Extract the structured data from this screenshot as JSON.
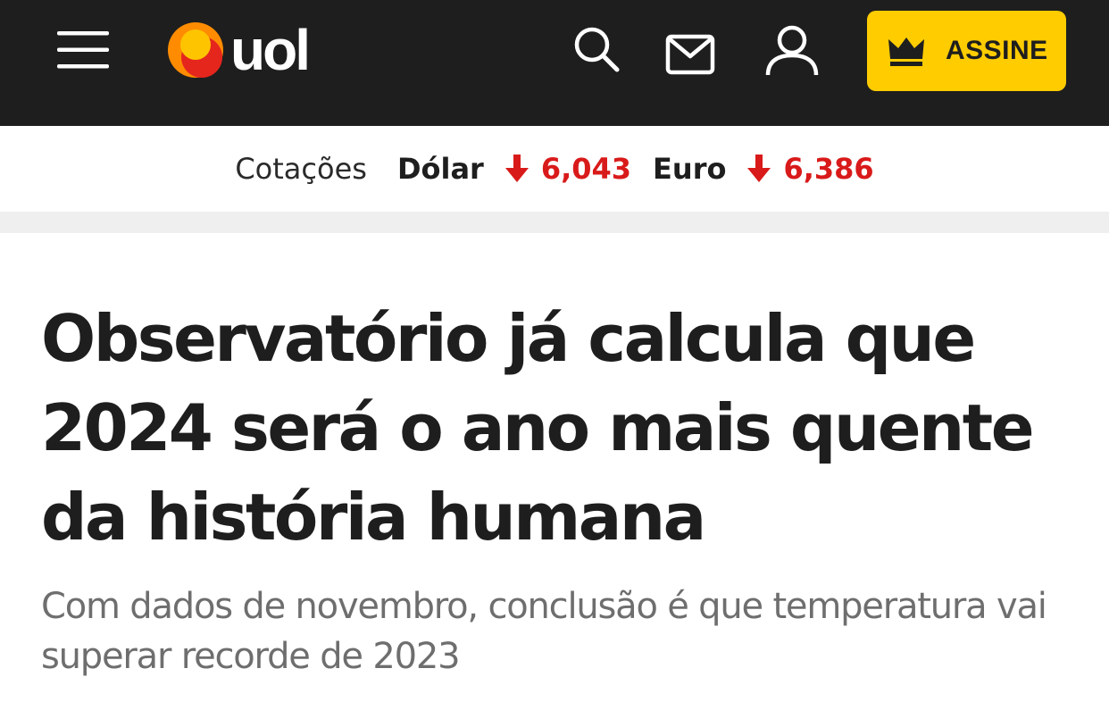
{
  "header": {
    "logo_text": "uol",
    "icons": {
      "menu": "menu-icon",
      "search": "search-icon",
      "mail": "mail-icon",
      "user": "user-icon",
      "crown": "crown-icon"
    },
    "subscribe_label": "ASSINE",
    "colors": {
      "background": "#1e1e1e",
      "accent": "#ffcc00",
      "logo_orange": "#ff8c00",
      "logo_red": "#e5261d"
    }
  },
  "quotes": {
    "label": "Cotações",
    "items": [
      {
        "currency": "Dólar",
        "trend": "down",
        "value": "6,043"
      },
      {
        "currency": "Euro",
        "trend": "down",
        "value": "6,386"
      }
    ],
    "down_color": "#d91a1a"
  },
  "article": {
    "headline": "Observatório já calcula que 2024 será o ano mais quente da história humana",
    "subtitle": "Com dados de novembro, conclusão é que temperatura vai superar recorde de 2023"
  }
}
